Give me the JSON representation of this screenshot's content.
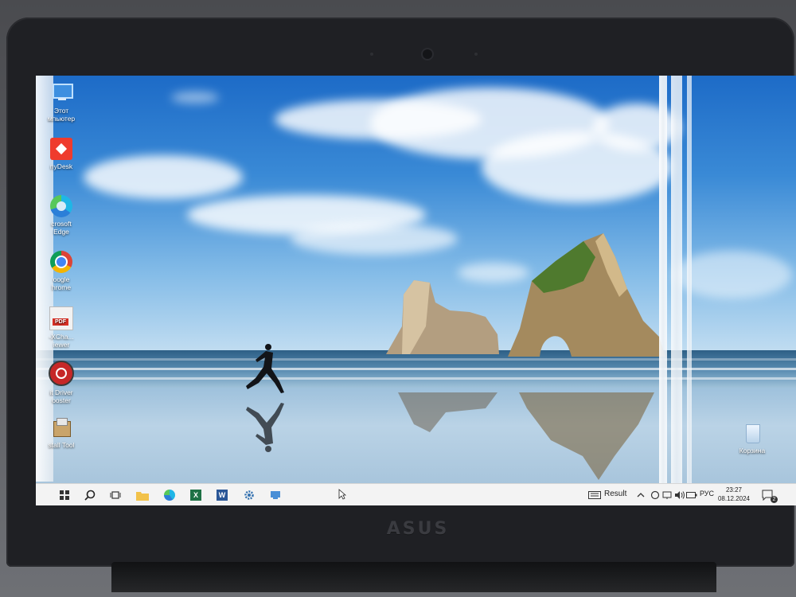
{
  "desktop": {
    "icons": [
      {
        "name": "this-pc",
        "label": "Этот\nмпьютер"
      },
      {
        "name": "anydesk",
        "label": "nyDesk"
      },
      {
        "name": "edge",
        "label": "crosoft\nEdge"
      },
      {
        "name": "chrome",
        "label": "oogle\nhrome"
      },
      {
        "name": "pdf-xchange",
        "label": "-XCha...\niewer"
      },
      {
        "name": "driver-booster",
        "label": "it Driver\nooster"
      },
      {
        "name": "install-tool",
        "label": "stall Tool"
      }
    ],
    "recycle_bin_label": "Корзина"
  },
  "taskbar": {
    "result_label": "Result",
    "language": "РУС",
    "time": "23:27",
    "date": "08.12.2024",
    "notification_count": "2"
  },
  "device": {
    "brand": "ASUS"
  },
  "colors": {
    "taskbar_bg": "#f3f3f3",
    "sky_top": "#1d6bc7",
    "bezel": "#1f2024"
  }
}
